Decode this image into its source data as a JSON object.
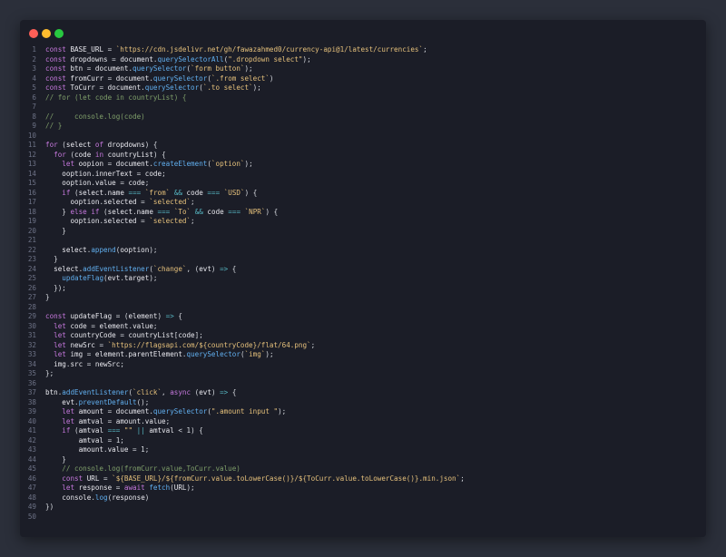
{
  "window": {
    "controls": [
      "close",
      "minimize",
      "maximize"
    ]
  },
  "code_lines": [
    "const BASE_URL = `https://cdn.jsdelivr.net/gh/fawazahmed0/currency-api@1/latest/currencies`;",
    "const dropdowns = document.querySelectorAll(\".dropdown select\");",
    "const btn = document.querySelector(`form button`);",
    "const fromCurr = document.querySelector(`.from select`)",
    "const ToCurr = document.querySelector(`.to select`);",
    "// for (let code in countryList) {",
    "",
    "//     console.log(code)",
    "// }",
    "",
    "for (select of dropdowns) {",
    "  for (code in countryList) {",
    "    let oopion = document.createElement(`option`);",
    "    ooption.innerText = code;",
    "    ooption.value = code;",
    "    if (select.name === `from` && code === `USD`) {",
    "      ooption.selected = `selected`;",
    "    } else if (select.name === `To` && code === `NPR`) {",
    "      ooption.selected = `selected`;",
    "    }",
    "",
    "    select.append(ooption);",
    "  }",
    "  select.addEventListener(`change`, (evt) => {",
    "    updateFlag(evt.target);",
    "  });",
    "}",
    "",
    "const updateFlag = (element) => {",
    "  let code = element.value;",
    "  let countryCode = countryList[code];",
    "  let newSrc = `https://flagsapi.com/${countryCode}/flat/64.png`;",
    "  let img = element.parentElement.querySelector(`img`);",
    "  img.src = newSrc;",
    "};",
    "",
    "btn.addEventListener(`click`, async (evt) => {",
    "    evt.preventDefault();",
    "    let amount = document.querySelector(\".amount input \");",
    "    let amtval = amount.value;",
    "    if (amtval === \"\" || amtval < 1) {",
    "        amtval = 1;",
    "        amount.value = 1;",
    "    }",
    "    // console.log(fromCurr.value,ToCurr.value)",
    "    const URL = `${BASE_URL}/${fromCurr.value.toLowerCase()}/${ToCurr.value.toLowerCase()}.min.json`;",
    "    let response = await fetch(URL);",
    "    console.log(response)",
    "})",
    ""
  ]
}
